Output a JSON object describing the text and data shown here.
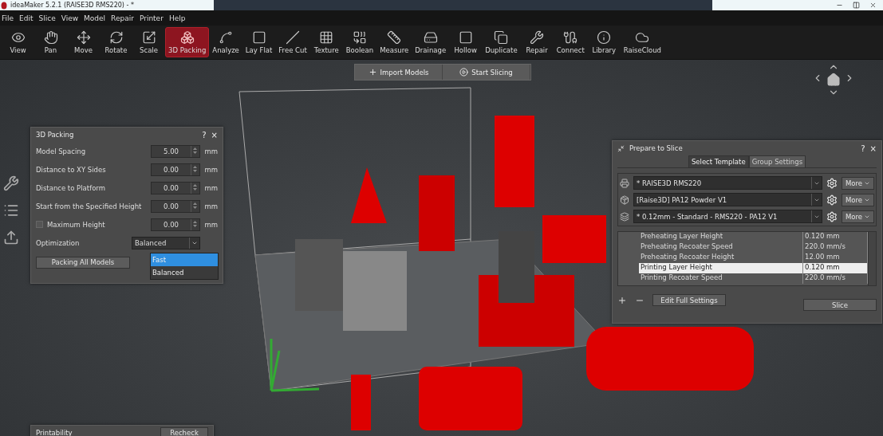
{
  "window": {
    "title": "ideaMaker 5.2.1 (RAISE3D RMS220) - *"
  },
  "menu": [
    "File",
    "Edit",
    "Slice",
    "View",
    "Model",
    "Repair",
    "Printer",
    "Help"
  ],
  "toolbar": [
    {
      "label": "View",
      "selected": false
    },
    {
      "label": "Pan",
      "selected": false
    },
    {
      "label": "Move",
      "selected": false
    },
    {
      "label": "Rotate",
      "selected": false
    },
    {
      "label": "Scale",
      "selected": false
    },
    {
      "label": "3D Packing",
      "selected": true
    },
    {
      "label": "Analyze",
      "selected": false
    },
    {
      "label": "Lay Flat",
      "selected": false
    },
    {
      "label": "Free Cut",
      "selected": false
    },
    {
      "label": "Texture",
      "selected": false
    },
    {
      "label": "Boolean",
      "selected": false
    },
    {
      "label": "Measure",
      "selected": false
    },
    {
      "label": "Drainage",
      "selected": false
    },
    {
      "label": "Hollow",
      "selected": false
    },
    {
      "label": "Duplicate",
      "selected": false
    },
    {
      "label": "Repair",
      "selected": false
    },
    {
      "label": "Connect",
      "selected": false
    },
    {
      "label": "Library",
      "selected": false
    },
    {
      "label": "RaiseCloud",
      "selected": false
    }
  ],
  "viewport_actions": [
    "Import Models",
    "Start Slicing"
  ],
  "packing_panel": {
    "title": "3D Packing",
    "help": "?",
    "close": "×",
    "fields": [
      {
        "kind": "number",
        "label": "Model Spacing",
        "value": "5.00",
        "unit": "mm"
      },
      {
        "kind": "number",
        "label": "Distance to XY Sides",
        "value": "0.00",
        "unit": "mm"
      },
      {
        "kind": "number",
        "label": "Distance to Platform",
        "value": "0.00",
        "unit": "mm"
      },
      {
        "kind": "number",
        "label": "Start from the Specified Height",
        "value": "0.00",
        "unit": "mm"
      },
      {
        "kind": "checkbox",
        "label": "Maximum Height",
        "checked": false,
        "value": "0.00",
        "unit": "mm"
      },
      {
        "kind": "select",
        "label": "Optimization",
        "value": "Balanced"
      }
    ],
    "options": [
      {
        "label": "Fast",
        "selected": true
      },
      {
        "label": "Balanced",
        "selected": false
      }
    ],
    "button": "Packing All Models"
  },
  "slice_panel": {
    "title": "Prepare to Slice",
    "help": "?",
    "close": "×",
    "tabs": [
      {
        "label": "Select Template",
        "selected": true
      },
      {
        "label": "Group Settings",
        "selected": false
      }
    ],
    "presets": [
      {
        "value": "* RAISE3D RMS220",
        "more": "More"
      },
      {
        "value": "[Raise3D] PA12 Powder V1",
        "more": "More"
      },
      {
        "value": "* 0.12mm - Standard - RMS220 - PA12 V1",
        "more": "More"
      }
    ],
    "settings": [
      {
        "name": "Preheating Layer Height",
        "value": "0.120 mm",
        "selected": false
      },
      {
        "name": "Preheating Recoater Speed",
        "value": "220.0 mm/s",
        "selected": false
      },
      {
        "name": "Preheating Recoater Height",
        "value": "12.00 mm",
        "selected": false
      },
      {
        "name": "Printing Layer Height",
        "value": "0.120 mm",
        "selected": true
      },
      {
        "name": "Printing Recoater Speed",
        "value": "220.0 mm/s",
        "selected": false
      }
    ],
    "edit_button": "Edit Full Settings",
    "slice_button": "Slice"
  },
  "printability_panel": {
    "title": "Printability",
    "button": "Recheck"
  }
}
